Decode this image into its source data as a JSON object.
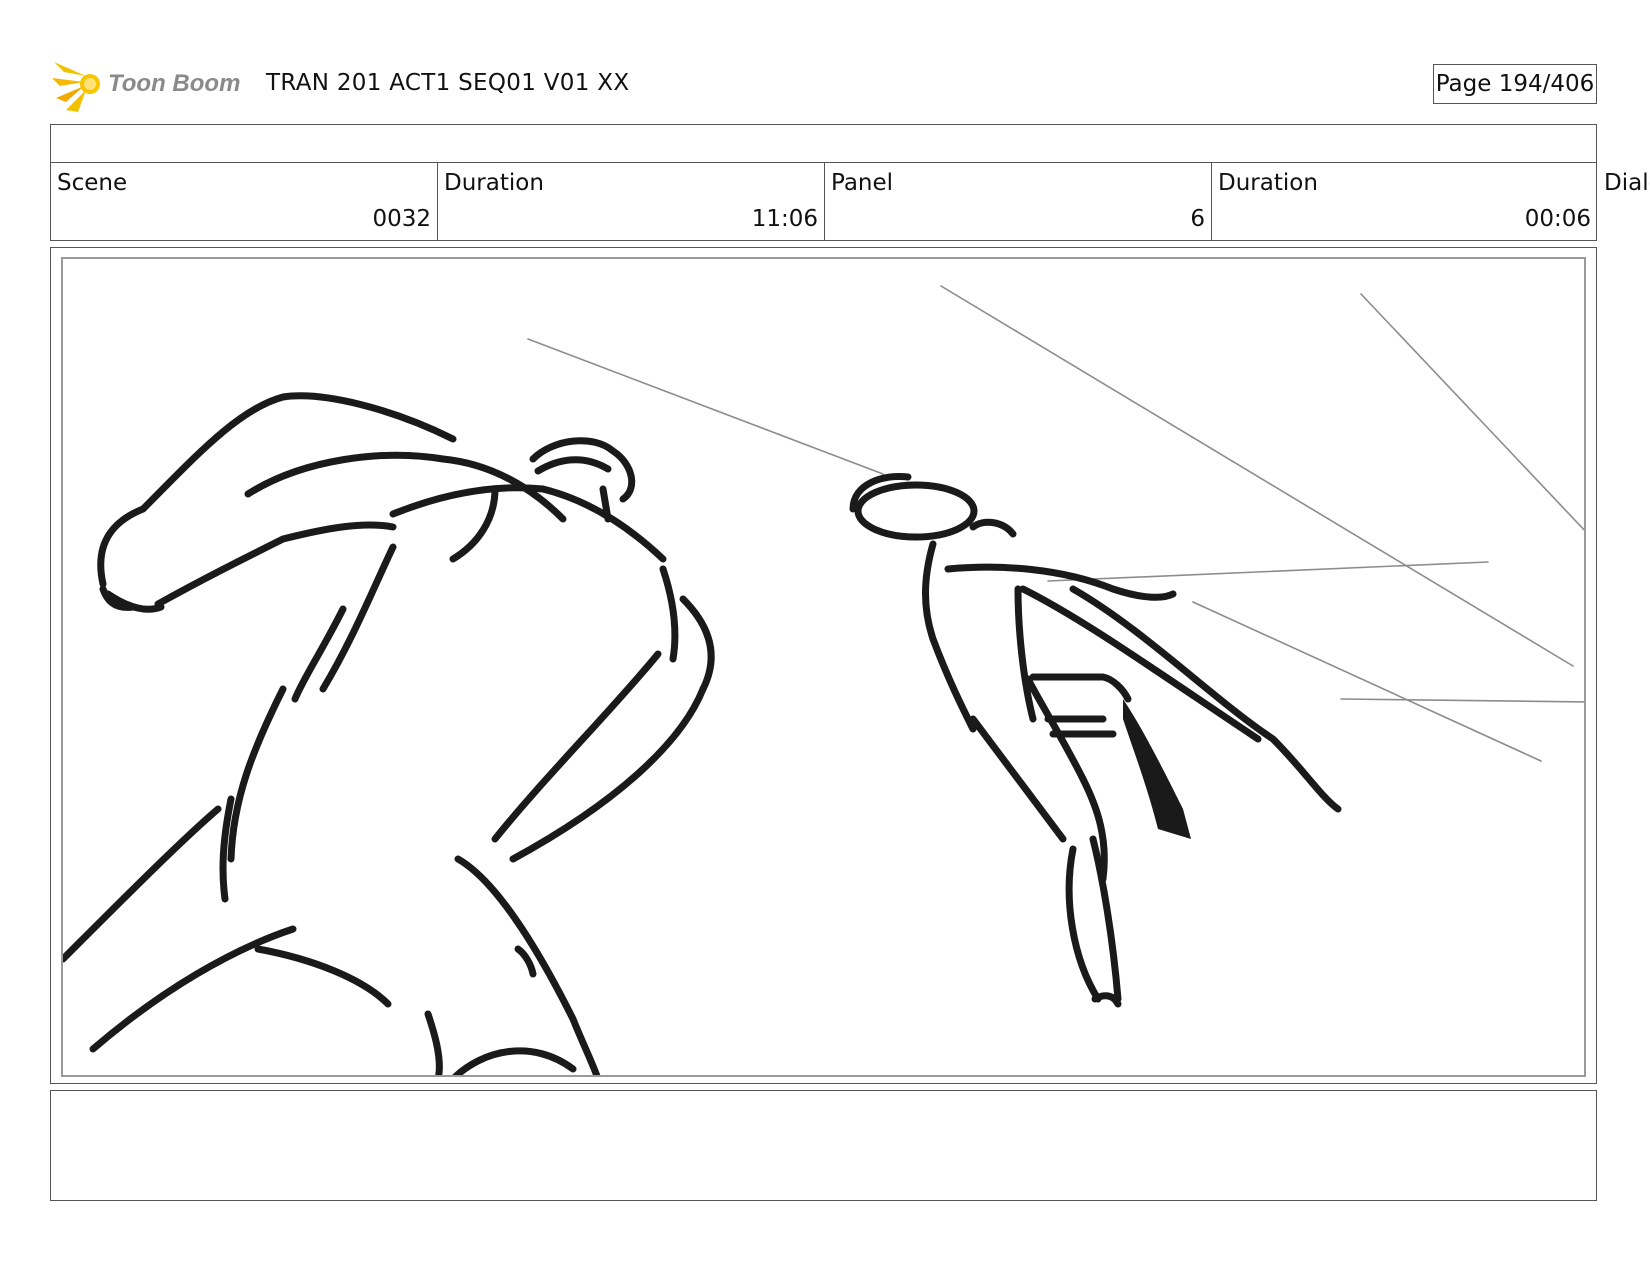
{
  "header": {
    "logo_text": "Toon Boom",
    "title": "TRAN 201 ACT1 SEQ01 V01 XX",
    "page_label": "Page 194/406"
  },
  "info": {
    "scene_label": "Scene",
    "scene_value": "0032",
    "scene_duration_label": "Duration",
    "scene_duration_value": "11:06",
    "panel_label": "Panel",
    "panel_value": "6",
    "panel_duration_label": "Duration",
    "panel_duration_value": "00:06",
    "dialog_label": "Dialo"
  },
  "panel": {
    "image": "storyboard-sketch",
    "line_color": "#1a1a1a",
    "speed_line_color": "#8c8c8c"
  },
  "colors": {
    "logo_accent": "#f2c200",
    "logo_text": "#8a8a8a",
    "border": "#555555"
  }
}
